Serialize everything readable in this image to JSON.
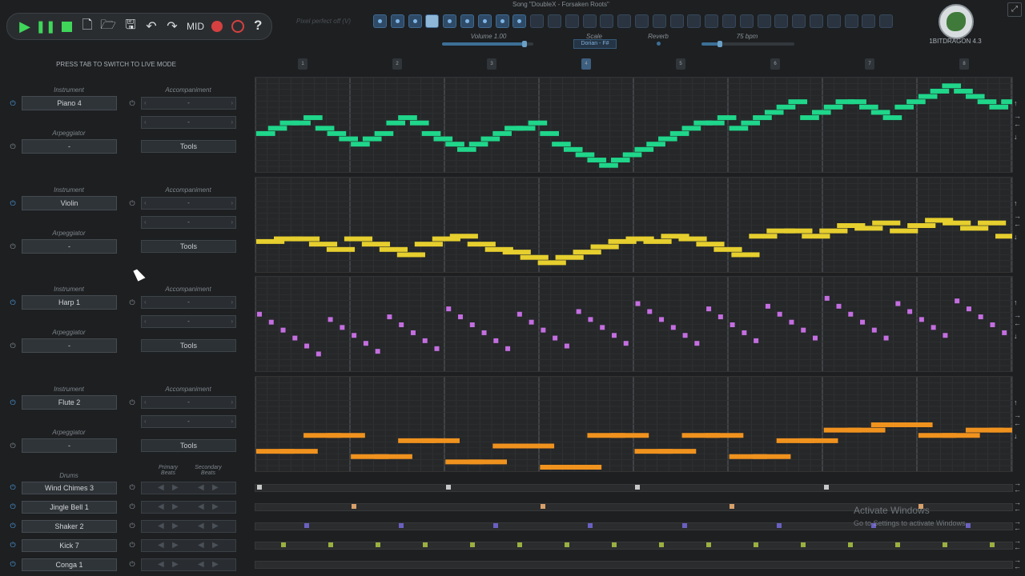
{
  "toolbar": {
    "buttons": [
      "play-icon",
      "pause-icon",
      "stop-icon",
      "new-file-icon",
      "open-folder-icon",
      "save-icon",
      "undo-icon",
      "redo-icon"
    ],
    "mid_label": "MID",
    "help_label": "?"
  },
  "header": {
    "song_title": "Song \"DoubleX - Forsaken Roots\"",
    "pitch_hint": "Pixel perfect off (V)",
    "volume_label": "Volume 1.00",
    "volume_level": 0.9,
    "scale_label": "Scale",
    "scale_value": "Dorian - F#",
    "reverb_label": "Reverb",
    "tempo_label": "75 bpm",
    "tempo_level": 0.2,
    "version": "1BITDRAGON 4.3"
  },
  "tab_hint": "PRESS TAB TO SWITCH TO LIVE MODE",
  "patterns": {
    "count": 30,
    "active": [
      true,
      true,
      true,
      "sel",
      true,
      true,
      true,
      true,
      true,
      false,
      false,
      false,
      false,
      false,
      false,
      false,
      false,
      false,
      false,
      false,
      false,
      false,
      false,
      false,
      false,
      false,
      false,
      false,
      false,
      false
    ]
  },
  "measures": [
    "1",
    "2",
    "3",
    "4",
    "5",
    "6",
    "7",
    "8"
  ],
  "selected_measure": 3,
  "instruments": [
    {
      "label_instrument": "Instrument",
      "name": "Piano 4",
      "label_accomp": "Accompaniment",
      "accomp1": "-",
      "accomp2": "-",
      "label_arp": "Arpeggiator",
      "arp": "-",
      "tools": "Tools",
      "color": "#1fd68a"
    },
    {
      "label_instrument": "Instrument",
      "name": "Violin",
      "label_accomp": "Accompaniment",
      "accomp1": "-",
      "accomp2": "-",
      "label_arp": "Arpeggiator",
      "arp": "-",
      "tools": "Tools",
      "color": "#e6cf2e"
    },
    {
      "label_instrument": "Instrument",
      "name": "Harp 1",
      "label_accomp": "Accompaniment",
      "accomp1": "-",
      "accomp2": "-",
      "label_arp": "Arpeggiator",
      "arp": "-",
      "tools": "Tools",
      "color": "#c46ee0"
    },
    {
      "label_instrument": "Instrument",
      "name": "Flute 2",
      "label_accomp": "Accompaniment",
      "accomp1": "-",
      "accomp2": "-",
      "label_arp": "Arpeggiator",
      "arp": "-",
      "tools": "Tools",
      "color": "#f0921e"
    }
  ],
  "drums": {
    "label": "Drums",
    "primary_label": "Primary Beats",
    "secondary_label": "Secondary Beats",
    "rows": [
      {
        "name": "Wind Chimes 3",
        "color": "#c8c8c8",
        "beats": [
          0,
          8,
          16,
          24
        ]
      },
      {
        "name": "Jingle Bell 1",
        "color": "#d8a06a",
        "beats": [
          4,
          12,
          20,
          28
        ]
      },
      {
        "name": "Shaker 2",
        "color": "#6a60c0",
        "beats": [
          2,
          6,
          10,
          14,
          18,
          22,
          26,
          30
        ]
      },
      {
        "name": "Kick 7",
        "color": "#9ab040",
        "beats": [
          1,
          3,
          5,
          7,
          9,
          11,
          13,
          15,
          17,
          19,
          21,
          23,
          25,
          27,
          29,
          31
        ]
      },
      {
        "name": "Conga 1",
        "color": "#808080",
        "beats": []
      }
    ]
  },
  "watermark": {
    "title": "Activate Windows",
    "subtitle": "Go to Settings to activate Windows."
  }
}
